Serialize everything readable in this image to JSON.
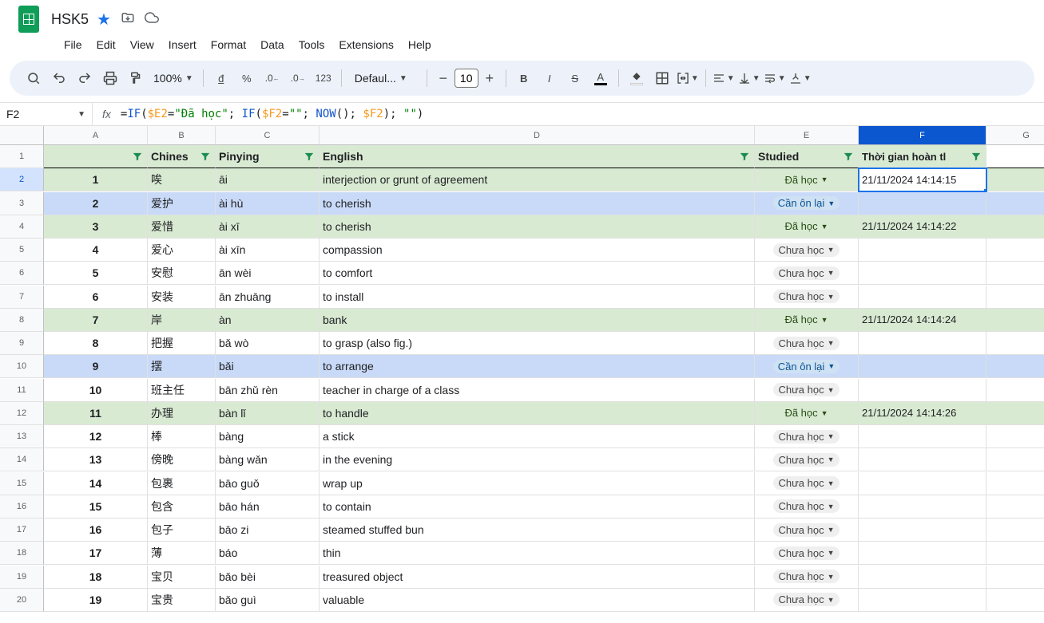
{
  "doc": {
    "title": "HSK5"
  },
  "menu": {
    "file": "File",
    "edit": "Edit",
    "view": "View",
    "insert": "Insert",
    "format": "Format",
    "data": "Data",
    "tools": "Tools",
    "extensions": "Extensions",
    "help": "Help"
  },
  "toolbar": {
    "zoom": "100%",
    "font": "Defaul...",
    "size": "10"
  },
  "namebox": "F2",
  "formula": {
    "raw": "=IF($E2=\"Đã học\"; IF($F2=\"\"; NOW(); $F2); \"\")"
  },
  "cols": [
    "A",
    "B",
    "C",
    "D",
    "E",
    "F",
    "G"
  ],
  "headers": {
    "A": "",
    "B": "Chines",
    "C": "Pinying",
    "D": "English",
    "E": "Studied",
    "F": "Thời gian hoàn tl"
  },
  "status": {
    "done": "Đã học",
    "review": "Cần ôn lại",
    "not": "Chưa học"
  },
  "rows": [
    {
      "n": "1",
      "a": "1",
      "b": "唉",
      "c": "āi",
      "d": "interjection or grunt of agreement",
      "e": "done",
      "f": "21/11/2024 14:14:15",
      "bg": "green"
    },
    {
      "n": "2",
      "a": "2",
      "b": "爱护",
      "c": "ài hù",
      "d": "to cherish",
      "e": "review",
      "f": "",
      "bg": "blue"
    },
    {
      "n": "3",
      "a": "3",
      "b": "爱惜",
      "c": "ài xī",
      "d": "to cherish",
      "e": "done",
      "f": "21/11/2024 14:14:22",
      "bg": "green"
    },
    {
      "n": "4",
      "a": "4",
      "b": "爱心",
      "c": "ài xīn",
      "d": "compassion",
      "e": "not",
      "f": "",
      "bg": ""
    },
    {
      "n": "5",
      "a": "5",
      "b": "安慰",
      "c": "ān wèi",
      "d": "to comfort",
      "e": "not",
      "f": "",
      "bg": ""
    },
    {
      "n": "6",
      "a": "6",
      "b": "安装",
      "c": "ān zhuāng",
      "d": "to install",
      "e": "not",
      "f": "",
      "bg": ""
    },
    {
      "n": "7",
      "a": "7",
      "b": "岸",
      "c": "àn",
      "d": "bank",
      "e": "done",
      "f": "21/11/2024 14:14:24",
      "bg": "green"
    },
    {
      "n": "8",
      "a": "8",
      "b": "把握",
      "c": "bǎ wò",
      "d": "to grasp (also fig.)",
      "e": "not",
      "f": "",
      "bg": ""
    },
    {
      "n": "9",
      "a": "9",
      "b": "摆",
      "c": "bǎi",
      "d": "to arrange",
      "e": "review",
      "f": "",
      "bg": "blue"
    },
    {
      "n": "10",
      "a": "10",
      "b": "班主任",
      "c": "bān zhǔ rèn",
      "d": "teacher in charge of a class",
      "e": "not",
      "f": "",
      "bg": ""
    },
    {
      "n": "11",
      "a": "11",
      "b": "办理",
      "c": "bàn lǐ",
      "d": "to handle",
      "e": "done",
      "f": "21/11/2024 14:14:26",
      "bg": "green"
    },
    {
      "n": "12",
      "a": "12",
      "b": "棒",
      "c": "bàng",
      "d": "a stick",
      "e": "not",
      "f": "",
      "bg": ""
    },
    {
      "n": "13",
      "a": "13",
      "b": "傍晚",
      "c": "bàng wǎn",
      "d": "in the evening",
      "e": "not",
      "f": "",
      "bg": ""
    },
    {
      "n": "14",
      "a": "14",
      "b": "包裹",
      "c": "bāo guǒ",
      "d": "wrap up",
      "e": "not",
      "f": "",
      "bg": ""
    },
    {
      "n": "15",
      "a": "15",
      "b": "包含",
      "c": "bāo hán",
      "d": "to contain",
      "e": "not",
      "f": "",
      "bg": ""
    },
    {
      "n": "16",
      "a": "16",
      "b": "包子",
      "c": "bāo zi",
      "d": "steamed stuffed bun",
      "e": "not",
      "f": "",
      "bg": ""
    },
    {
      "n": "17",
      "a": "17",
      "b": "薄",
      "c": "báo",
      "d": "thin",
      "e": "not",
      "f": "",
      "bg": ""
    },
    {
      "n": "18",
      "a": "18",
      "b": "宝贝",
      "c": "bǎo bèi",
      "d": "treasured object",
      "e": "not",
      "f": "",
      "bg": ""
    },
    {
      "n": "19",
      "a": "19",
      "b": "宝贵",
      "c": "bǎo guì",
      "d": "valuable",
      "e": "not",
      "f": "",
      "bg": ""
    }
  ],
  "selected": {
    "row": 0,
    "col": "F"
  }
}
